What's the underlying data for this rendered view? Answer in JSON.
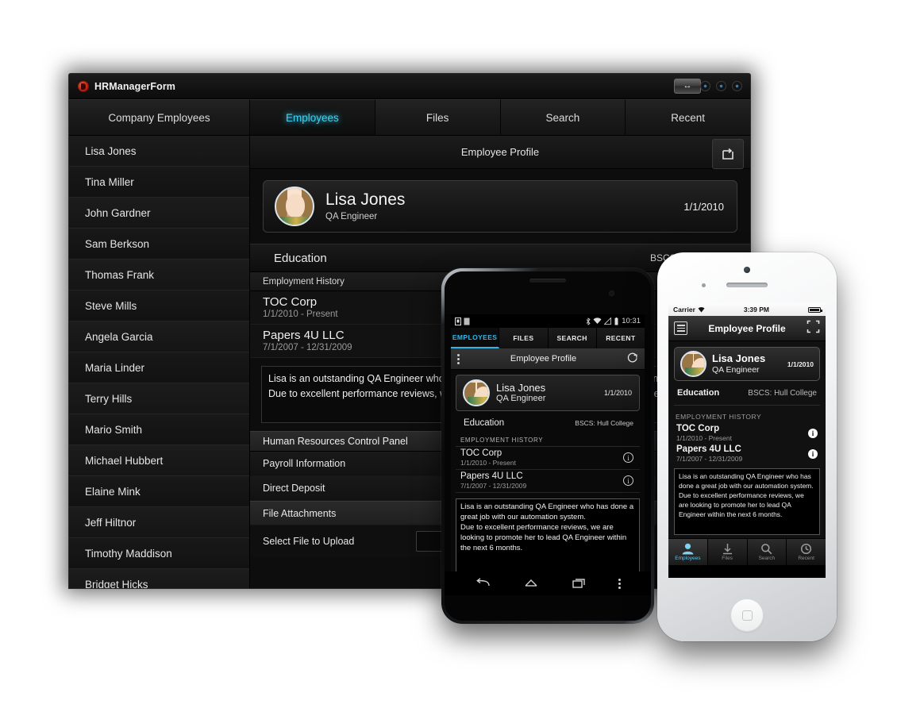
{
  "desktop": {
    "window_title": "HRManagerForm",
    "titlebar": {
      "resize_icon": "resize-horizontal-icon",
      "buttons": [
        "minimize-button",
        "maximize-button",
        "close-button"
      ]
    },
    "left_pane_tab": "Company Employees",
    "tabs": [
      {
        "label": "Employees",
        "active": true
      },
      {
        "label": "Files",
        "active": false
      },
      {
        "label": "Search",
        "active": false
      },
      {
        "label": "Recent",
        "active": false
      }
    ],
    "employees": [
      "Lisa Jones",
      "Tina Miller",
      "John Gardner",
      "Sam Berkson",
      "Thomas Frank",
      "Steve Mills",
      "Angela Garcia",
      "Maria Linder",
      "Terry Hills",
      "Mario Smith",
      "Michael Hubbert",
      "Elaine Mink",
      "Jeff Hiltnor",
      "Timothy Maddison",
      "Bridget Hicks"
    ],
    "content_header": {
      "title": "Employee Profile",
      "action_icon": "expand-fullscreen-icon"
    },
    "profile": {
      "name": "Lisa Jones",
      "role": "QA Engineer",
      "date": "1/1/2010",
      "avatar": "employee-avatar"
    },
    "education": {
      "label": "Education",
      "value": "BSCS: Hull College"
    },
    "employment_history_label": "Employment History",
    "jobs": [
      {
        "company": "TOC Corp",
        "dates": "1/1/2010 - Present"
      },
      {
        "company": "Papers 4U LLC",
        "dates": "7/1/2007 - 12/31/2009"
      }
    ],
    "notes_line1": "Lisa is an outstanding QA Engineer who has done a great job with our automation system.",
    "notes_line2": "Due to excellent performance reviews, we are looking to promote her to lead QA Engineer within the next 6 months.",
    "control_panel": {
      "header": "Human Resources Control Panel",
      "items": [
        "Payroll Information",
        "Direct Deposit",
        "File Attachments"
      ],
      "upload_label": "Select File to Upload",
      "upload_value": ""
    }
  },
  "android": {
    "status": {
      "time": "10:31",
      "left_icons": [
        "sim-icon",
        "sd-card-icon"
      ],
      "right_icons": [
        "bluetooth-icon",
        "wifi-icon",
        "signal-icon",
        "battery-icon"
      ]
    },
    "tabs": [
      {
        "label": "EMPLOYEES",
        "active": true
      },
      {
        "label": "FILES",
        "active": false
      },
      {
        "label": "SEARCH",
        "active": false
      },
      {
        "label": "RECENT",
        "active": false
      }
    ],
    "actionbar": {
      "overflow_icon": "overflow-menu-icon",
      "title": "Employee Profile",
      "refresh_icon": "refresh-icon"
    },
    "profile": {
      "name": "Lisa Jones",
      "role": "QA Engineer",
      "date": "1/1/2010"
    },
    "education": {
      "label": "Education",
      "value": "BSCS: Hull College"
    },
    "employment_history_label": "EMPLOYMENT HISTORY",
    "jobs": [
      {
        "company": "TOC Corp",
        "dates": "1/1/2010 - Present",
        "info": "i"
      },
      {
        "company": "Papers 4U LLC",
        "dates": "7/1/2007 - 12/31/2009",
        "info": "i"
      }
    ],
    "notes": "Lisa is an outstanding QA Engineer who has done a great job with our automation system.\nDue to excellent performance reviews, we are looking to promote her to lead QA Engineer within the next 6 months.",
    "nav": [
      "back-icon",
      "home-icon",
      "recents-icon",
      "menu-icon"
    ]
  },
  "iphone": {
    "status": {
      "carrier": "Carrier",
      "wifi_icon": "wifi-icon",
      "time": "3:39 PM",
      "battery_icon": "battery-icon"
    },
    "navbar": {
      "menu_icon": "list-menu-icon",
      "title": "Employee Profile",
      "action_icon": "expand-fullscreen-icon"
    },
    "profile": {
      "name": "Lisa Jones",
      "role": "QA Engineer",
      "date": "1/1/2010"
    },
    "education": {
      "label": "Education",
      "value": "BSCS: Hull College"
    },
    "employment_history_label": "EMPLOYMENT HISTORY",
    "jobs": [
      {
        "company": "TOC Corp",
        "dates": "1/1/2010 - Present",
        "info": "i"
      },
      {
        "company": "Papers 4U LLC",
        "dates": "7/1/2007 - 12/31/2009",
        "info": "i"
      }
    ],
    "notes": "Lisa is an outstanding QA Engineer who has done a great job with our automation system.\nDue to excellent performance reviews, we are looking to promote her to lead QA Engineer within the next 6 months.",
    "tabbar": [
      {
        "label": "Employees",
        "icon": "person-icon",
        "active": true
      },
      {
        "label": "Files",
        "icon": "download-icon",
        "active": false
      },
      {
        "label": "Search",
        "icon": "search-icon",
        "active": false
      },
      {
        "label": "Recent",
        "icon": "clock-icon",
        "active": false
      }
    ]
  },
  "colors": {
    "accent_cyan": "#33b5e5",
    "window_bg": "#0d0d0d",
    "panel_bg": "#1a1a1a",
    "text_primary": "#f0f0f0",
    "text_muted": "#9a9a9a"
  }
}
